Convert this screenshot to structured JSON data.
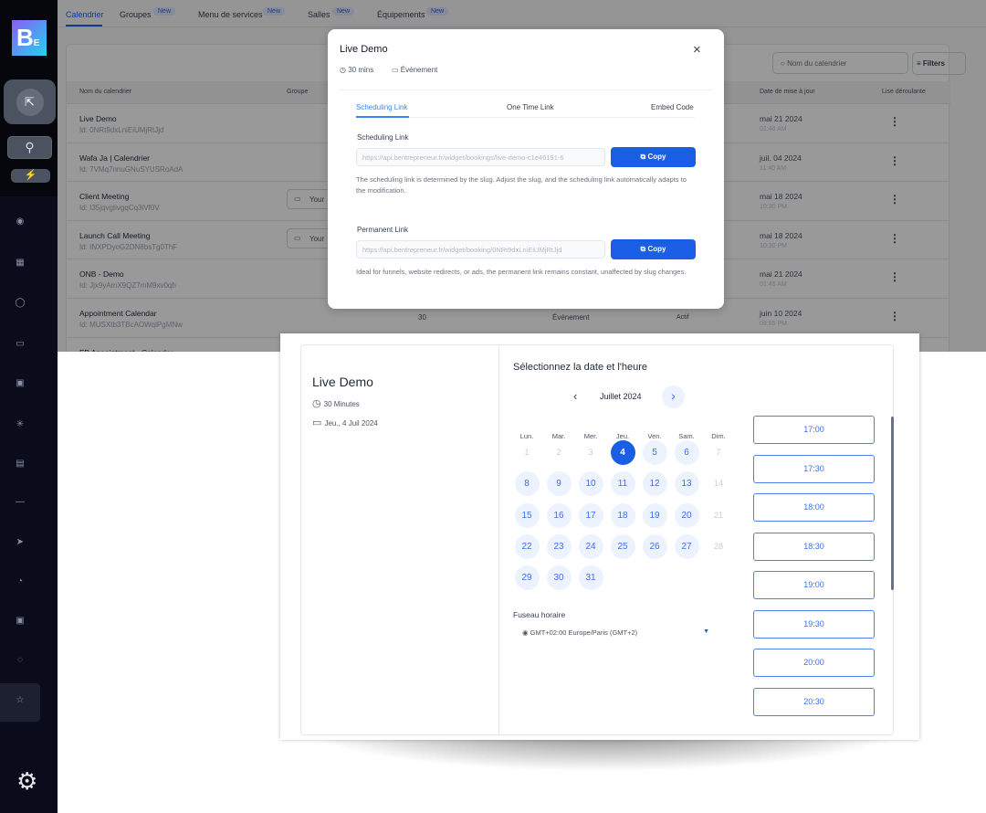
{
  "sidebar": {
    "logo": "BE",
    "icons": [
      "pointer-click-icon",
      "search-icon",
      "lightning-icon",
      "eye-icon",
      "grid-icon",
      "chat-icon",
      "calendar-icon",
      "inbox-icon",
      "network-icon",
      "list-icon",
      "minus-icon",
      "send-icon",
      "gauge-icon",
      "media-icon",
      "bulb-icon",
      "star-icon",
      "gear-icon"
    ]
  },
  "tabs": [
    {
      "label": "Calendrier",
      "new": ""
    },
    {
      "label": "Groupes",
      "new": "New"
    },
    {
      "label": "Menu de services",
      "new": "New"
    },
    {
      "label": "Salles",
      "new": "New"
    },
    {
      "label": "Équipements",
      "new": "New"
    }
  ],
  "table": {
    "search_placeholder": "Nom du calendrier",
    "filters": "Filters",
    "headers": [
      "Nom du calendrier",
      "Groupe",
      "Date de mise à jour",
      "Lise déroulante"
    ],
    "rows": [
      {
        "name": "Live Demo",
        "id": "Id: 0NRt9dxLniEiUMjRtJjd",
        "group": "",
        "date": "mai 21 2024",
        "time": "01:46 AM"
      },
      {
        "name": "Wafa Ja  | Calendrier",
        "id": "Id: 7VMq7nnuGNuSYUSRoAdA",
        "group": "",
        "date": "juil. 04 2024",
        "time": "11:40 AM"
      },
      {
        "name": "Client Meeting",
        "id": "Id: I35jqvgtivgqCq3iVf0V",
        "group": "Your",
        "date": "mai 18 2024",
        "time": "10:30 PM"
      },
      {
        "name": "Launch Call Meeting",
        "id": "Id: INXPDyoG2DN8bsTg0ThF",
        "group": "Your",
        "date": "mai 18 2024",
        "time": "10:30 PM"
      },
      {
        "name": "ONB - Demo",
        "id": "Id: Jjx9yAmX9QZ7mM9xv0qh",
        "group": "",
        "date": "mai 21 2024",
        "time": "01:45 AM"
      },
      {
        "name": "Appointment Calendar",
        "id": "Id: MUSXtb3TBcAOWqlPgMNw",
        "group": "",
        "date": "juin 10 2024",
        "time": "09:55 PM",
        "duration": "30",
        "type": "Événement",
        "status": "Actif"
      },
      {
        "name": "FB Appointment - Calendar",
        "id": "",
        "group": "",
        "date": "",
        "time": ""
      }
    ]
  },
  "modal": {
    "title": "Live Demo",
    "duration": "30 mins",
    "type": "Événement",
    "tabs": [
      "Scheduling Link",
      "One Time Link",
      "Embed Code"
    ],
    "scheduling_label": "Scheduling Link",
    "scheduling_url": "https://api.bentrepreneur.fr/widget/bookings/live-demo-c1e46191-6",
    "scheduling_help": "The scheduling link is determined by the slug. Adjust the slug, and the scheduling link automatically adapts to the modification.",
    "permanent_label": "Permanent Link",
    "permanent_url": "https://api.bentrepreneur.fr/widget/booking/0NRt9dxLniEiUMjRtJjd",
    "permanent_help": "Ideal for funnels, website redirects, or ads, the permanent link remains constant, unaffected by slug changes.",
    "copy": "Copy"
  },
  "widget": {
    "title": "Live Demo",
    "duration": "30 Minutes",
    "date": "Jeu., 4 Juil 2024",
    "heading": "Sélectionnez la date et l'heure",
    "month": "Juillet 2024",
    "weekdays": [
      "Lun.",
      "Mar.",
      "Mer.",
      "Jeu.",
      "Ven.",
      "Sam.",
      "Dim."
    ],
    "days_in_month": 31,
    "selected_day": 4,
    "disabled_days": [
      1,
      2,
      3,
      7,
      14,
      21,
      28
    ],
    "timezone_label": "Fuseau horaire",
    "timezone": "GMT+02:00 Europe/Paris (GMT+2)",
    "slots": [
      "17:00",
      "17:30",
      "18:00",
      "18:30",
      "19:00",
      "19:30",
      "20:00",
      "20:30"
    ]
  },
  "colors": {
    "primary": "#1a5ee6",
    "day_bg": "#edf3fe",
    "sidebar": "#0a0c1c"
  }
}
